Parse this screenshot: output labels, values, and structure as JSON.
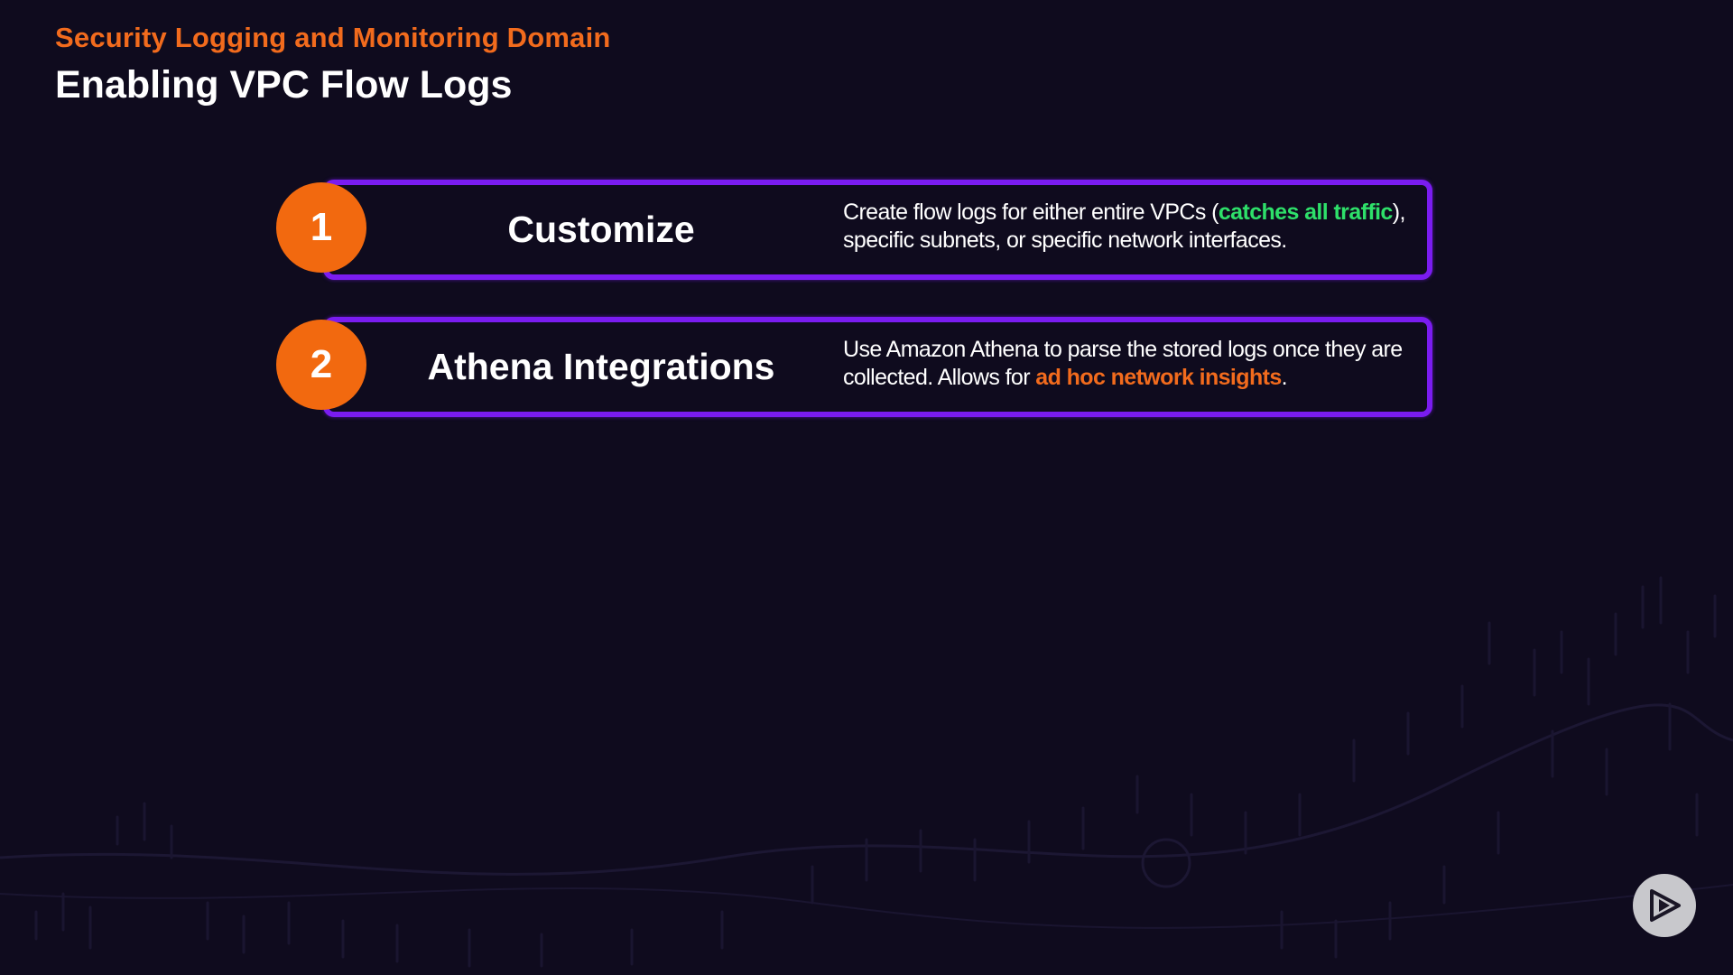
{
  "header": {
    "kicker": "Security Logging and Monitoring Domain",
    "title": "Enabling VPC Flow Logs"
  },
  "steps": [
    {
      "number": "1",
      "heading": "Customize",
      "desc_before": "Create flow logs for either entire VPCs (",
      "desc_highlight": "catches all traffic",
      "desc_after": "), specific subnets, or specific network interfaces."
    },
    {
      "number": "2",
      "heading": "Athena Integrations",
      "desc_before": "Use Amazon Athena to parse the stored logs once they are collected. Allows for ",
      "desc_highlight": "ad hoc network insights",
      "desc_after": "."
    }
  ],
  "branding": {
    "logo_icon": "play-logo-icon"
  },
  "colors": {
    "background": "#0f0b1e",
    "accent_orange": "#f26b1d",
    "border_purple": "#7a1cf0",
    "highlight_green": "#2ee06a"
  }
}
